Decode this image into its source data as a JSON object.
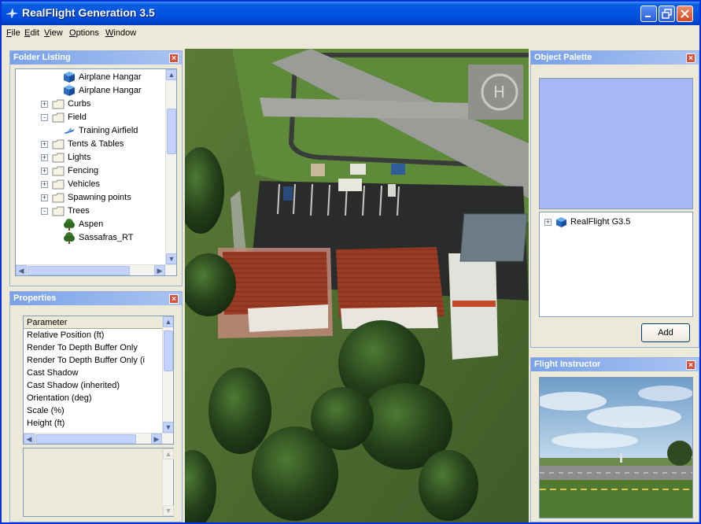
{
  "window": {
    "title": "RealFlight Generation 3.5"
  },
  "menubar": {
    "items": [
      {
        "label": "File",
        "underline": "F",
        "rest": "ile"
      },
      {
        "label": "Edit",
        "underline": "E",
        "rest": "dit"
      },
      {
        "label": "View",
        "underline": "V",
        "rest": "iew"
      },
      {
        "label": "Options",
        "underline": "O",
        "rest": "ptions"
      },
      {
        "label": "Window",
        "underline": "W",
        "rest": "indow"
      }
    ]
  },
  "folder_listing": {
    "title": "Folder Listing",
    "items": [
      {
        "label": "Airplane Hangar",
        "type": "object"
      },
      {
        "label": "Airplane Hangar",
        "type": "object"
      },
      {
        "label": "Curbs",
        "type": "folder",
        "expander": "+"
      },
      {
        "label": "Field",
        "type": "folder",
        "expander": "-"
      },
      {
        "label": "Training Airfield",
        "type": "airfield"
      },
      {
        "label": "Tents & Tables",
        "type": "folder",
        "expander": "+"
      },
      {
        "label": "Lights",
        "type": "folder",
        "expander": "+"
      },
      {
        "label": "Fencing",
        "type": "folder",
        "expander": "+"
      },
      {
        "label": "Vehicles",
        "type": "folder",
        "expander": "+"
      },
      {
        "label": "Spawning points",
        "type": "folder",
        "expander": "+"
      },
      {
        "label": "Trees",
        "type": "folder",
        "expander": "-"
      },
      {
        "label": "Aspen",
        "type": "tree"
      },
      {
        "label": "Sassafras_RT",
        "type": "tree"
      }
    ]
  },
  "properties": {
    "title": "Properties",
    "header": "Parameter",
    "rows": [
      "Relative Position (ft)",
      "Render To Depth Buffer Only",
      "Render To Depth Buffer Only (i",
      "Cast Shadow",
      "Cast Shadow (inherited)",
      "Orientation (deg)",
      "Scale (%)",
      "Height (ft)"
    ]
  },
  "object_palette": {
    "title": "Object Palette",
    "tree_item": "RealFlight G3.5",
    "add_label": "Add"
  },
  "flight_instructor": {
    "title": "Flight Instructor"
  },
  "icons": {
    "close": "close-icon",
    "minimize": "minimize-icon",
    "maximize": "maximize-icon"
  },
  "colors": {
    "titlebar": "#0054e3",
    "panel_title": "#7aa2e8",
    "palette_bg": "#a7b6f6",
    "grass": "#4b6a2f"
  }
}
